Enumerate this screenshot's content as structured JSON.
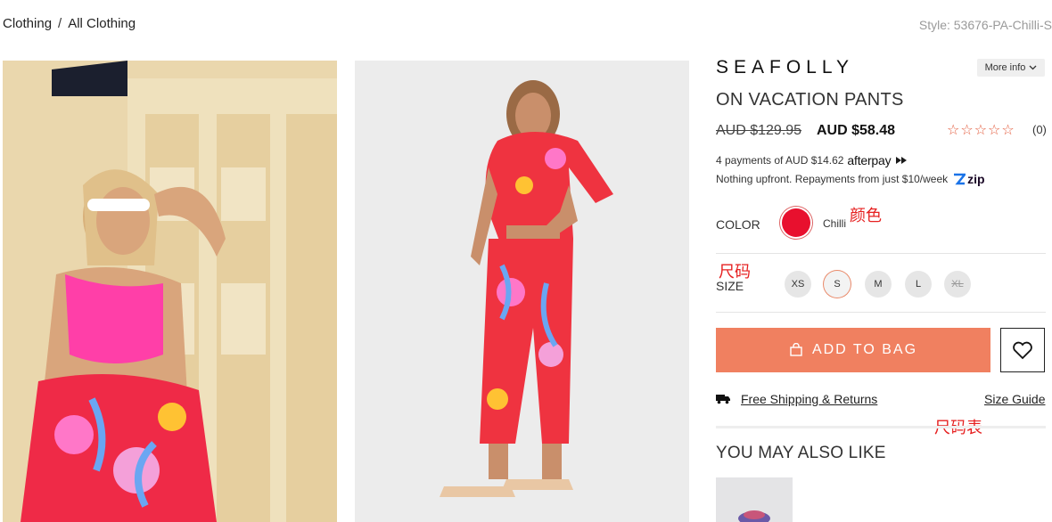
{
  "breadcrumb": {
    "items": [
      "Clothing",
      "All Clothing"
    ],
    "separator": "/"
  },
  "style_code": "Style: 53676-PA-Chilli-S",
  "product": {
    "brand": "SEAFOLLY",
    "more_info_label": "More info",
    "name": "ON VACATION PANTS",
    "price_original": "AUD $129.95",
    "price_sale": "AUD $58.48",
    "rating_stars": "☆☆☆☆☆",
    "review_count": "(0)",
    "afterpay_text": "4 payments of AUD $14.62",
    "afterpay_logo": "afterpay",
    "zip_text": "Nothing upfront. Repayments from just $10/week",
    "zip_logo": "zip"
  },
  "color": {
    "label": "COLOR",
    "selected_name": "Chilli",
    "swatch_hex": "#e8102e",
    "annotation": "颜色"
  },
  "size": {
    "label": "SIZE",
    "annotation": "尺码",
    "options": [
      {
        "label": "XS",
        "state": "available"
      },
      {
        "label": "S",
        "state": "selected"
      },
      {
        "label": "M",
        "state": "available"
      },
      {
        "label": "L",
        "state": "available"
      },
      {
        "label": "XL",
        "state": "unavailable"
      }
    ]
  },
  "actions": {
    "add_to_bag": "ADD TO BAG",
    "wishlist_icon": "heart-icon",
    "shipping_link": "Free Shipping & Returns",
    "size_guide": "Size Guide",
    "size_guide_annotation": "尺码表"
  },
  "recommendations": {
    "title": "YOU MAY ALSO LIKE"
  },
  "colors": {
    "accent": "#f08060",
    "annotation": "#e62020"
  }
}
